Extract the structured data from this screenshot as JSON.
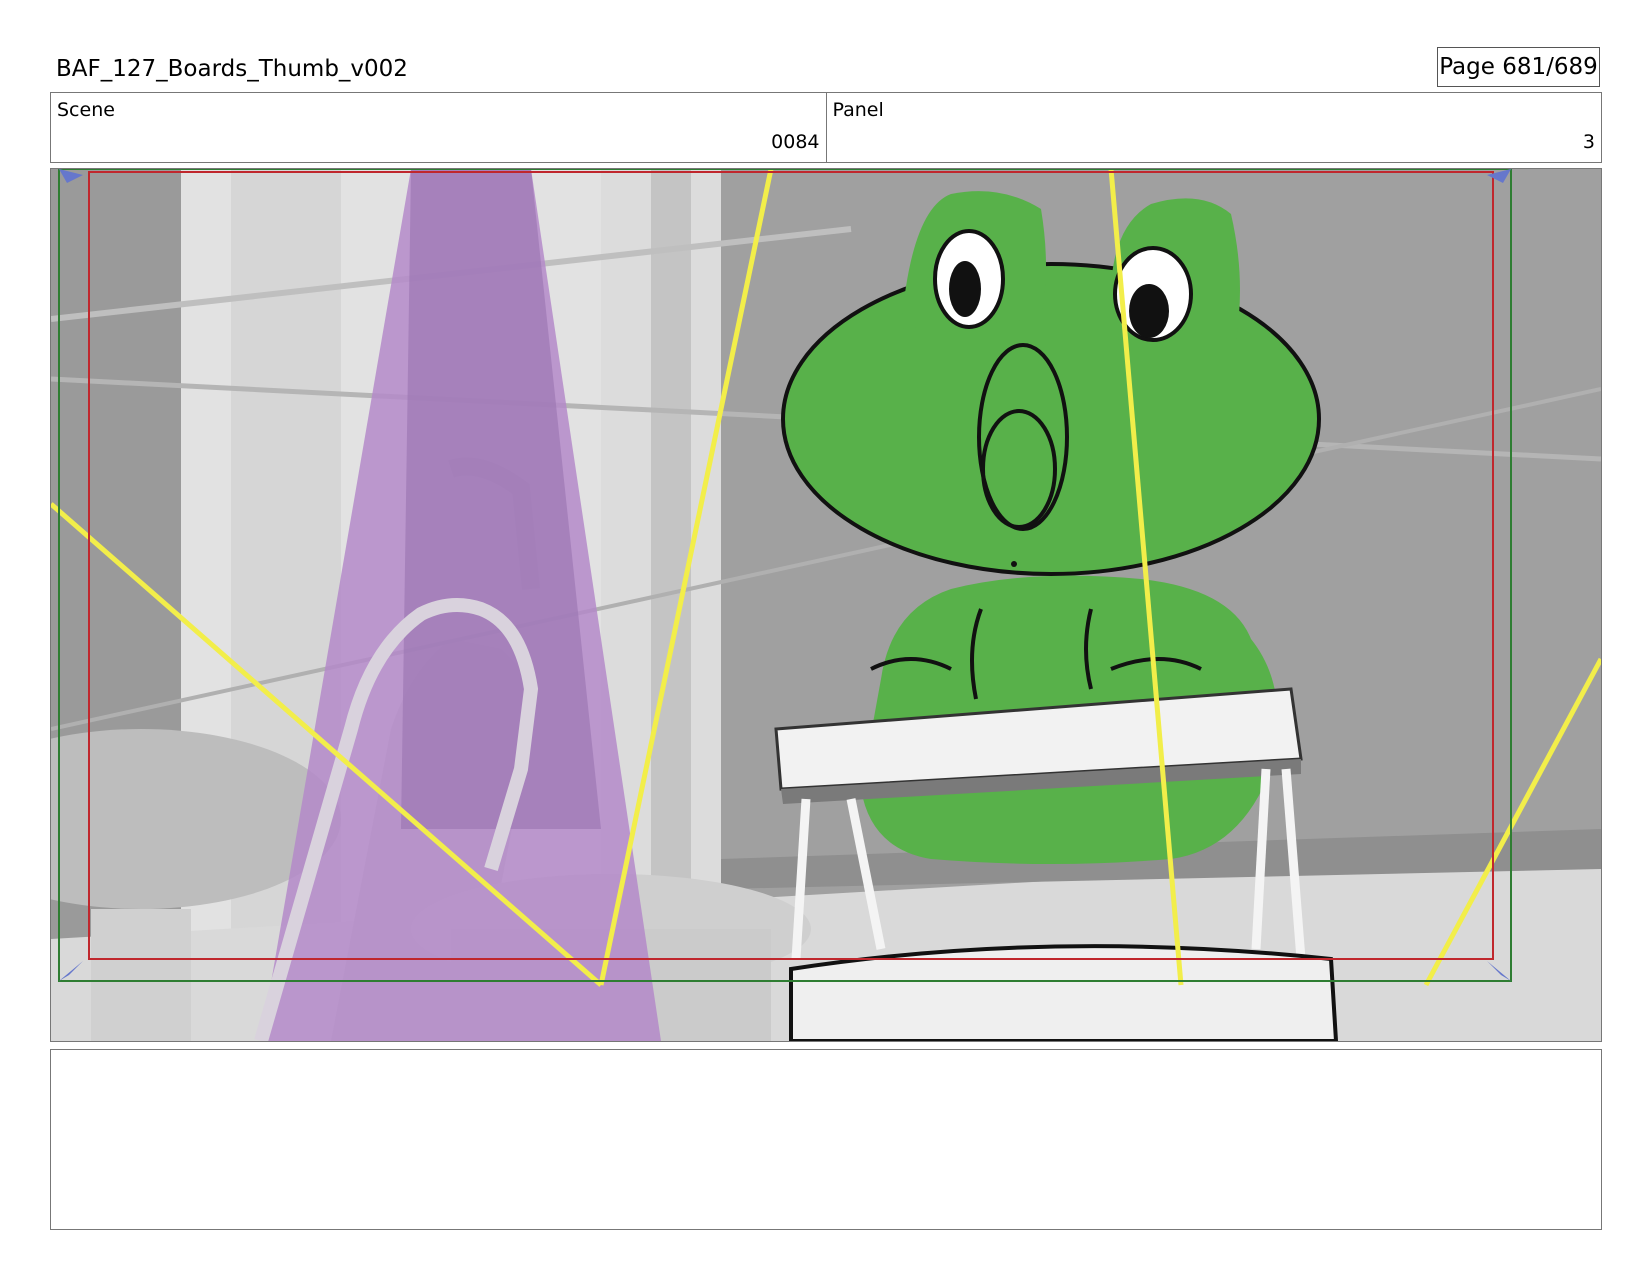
{
  "document": {
    "title": "BAF_127_Boards_Thumb_v002",
    "page_indicator": "Page 681/689"
  },
  "scene": {
    "label": "Scene",
    "value": "0084"
  },
  "panel": {
    "label": "Panel",
    "value": "3"
  },
  "notes": {
    "text": ""
  },
  "colors": {
    "frog_green": "#58b14a",
    "purple_light": "#b48ac9",
    "guide_yellow": "#f2ee4a",
    "safe_frame_red": "#c0272d",
    "action_frame_green": "#2e7d32",
    "background_gray": "#a0a0a0"
  }
}
